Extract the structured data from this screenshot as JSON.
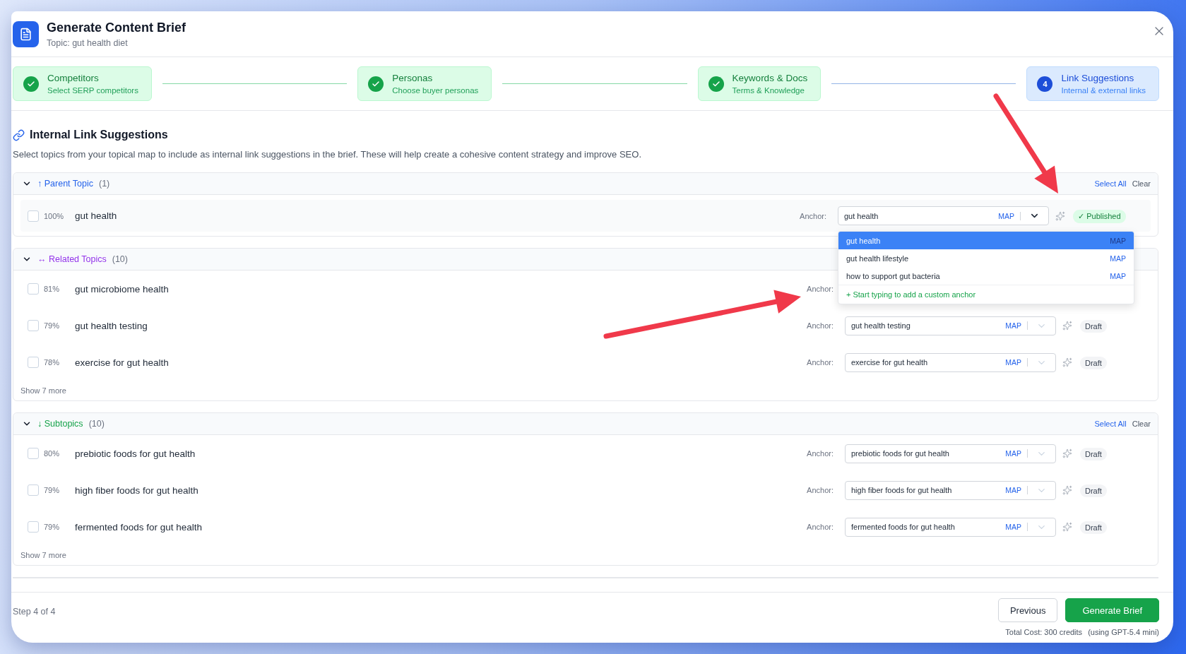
{
  "dialog": {
    "title": "Generate Content Brief",
    "subtitle": "Topic: gut health diet"
  },
  "steps": [
    {
      "title": "Competitors",
      "subtitle": "Select SERP competitors",
      "completed": true
    },
    {
      "title": "Personas",
      "subtitle": "Choose buyer personas",
      "completed": true
    },
    {
      "title": "Keywords & Docs",
      "subtitle": "Terms & Knowledge",
      "completed": true
    },
    {
      "title": "Link Suggestions",
      "subtitle": "Internal & external links",
      "completed": false,
      "number": "4"
    }
  ],
  "section": {
    "title": "Internal Link Suggestions",
    "description": "Select topics from your topical map to include as internal link suggestions in the brief. These will help create a cohesive content strategy and improve SEO."
  },
  "groups": [
    {
      "label": "↑ Parent Topic",
      "count": "(1)",
      "color": "#2563eb",
      "expanded": true,
      "actions": [
        {
          "label": "Select All",
          "kind": "select"
        },
        {
          "label": "Clear",
          "kind": "clear"
        }
      ],
      "rows": [
        {
          "score": "100%",
          "name": "gut health",
          "checked": false,
          "anchor_label": "Anchor:",
          "anchor": {
            "value": "gut health",
            "tag": "MAP",
            "open": true,
            "options": [
              {
                "label": "gut health",
                "tag": "MAP",
                "selected": true
              },
              {
                "label": "gut health lifestyle",
                "tag": "MAP",
                "selected": false
              },
              {
                "label": "how to support gut bacteria",
                "tag": "MAP",
                "selected": false
              }
            ],
            "hint": "+ Start typing to add a custom anchor"
          },
          "status": {
            "kind": "published",
            "label": "✓ Published"
          }
        }
      ]
    },
    {
      "label": "↔ Related Topics",
      "count": "(10)",
      "color": "#9333ea",
      "expanded": true,
      "rows": [
        {
          "score": "81%",
          "name": "gut microbiome health",
          "checked": false,
          "anchor_label": "Anchor:"
        },
        {
          "score": "79%",
          "name": "gut health testing",
          "checked": false,
          "anchor_label": "Anchor:",
          "anchor": {
            "value": "gut health testing",
            "tag": "MAP",
            "open": false
          },
          "status": {
            "kind": "draft",
            "label": "Draft"
          }
        },
        {
          "score": "78%",
          "name": "exercise for gut health",
          "checked": false,
          "anchor_label": "Anchor:",
          "anchor": {
            "value": "exercise for gut health",
            "tag": "MAP",
            "open": false
          },
          "status": {
            "kind": "draft",
            "label": "Draft"
          }
        }
      ],
      "show_more": "Show 7 more"
    },
    {
      "label": "↓ Subtopics",
      "count": "(10)",
      "color": "#16a34a",
      "expanded": true,
      "actions": [
        {
          "label": "Select All",
          "kind": "select"
        },
        {
          "label": "Clear",
          "kind": "clear"
        }
      ],
      "rows": [
        {
          "score": "80%",
          "name": "prebiotic foods for gut health",
          "checked": false,
          "anchor_label": "Anchor:",
          "anchor": {
            "value": "prebiotic foods for gut health",
            "tag": "MAP",
            "open": false
          },
          "status": {
            "kind": "draft",
            "label": "Draft"
          }
        },
        {
          "score": "79%",
          "name": "high fiber foods for gut health",
          "checked": false,
          "anchor_label": "Anchor:",
          "anchor": {
            "value": "high fiber foods for gut health",
            "tag": "MAP",
            "open": false
          },
          "status": {
            "kind": "draft",
            "label": "Draft"
          }
        },
        {
          "score": "79%",
          "name": "fermented foods for gut health",
          "checked": false,
          "anchor_label": "Anchor:",
          "anchor": {
            "value": "fermented foods for gut health",
            "tag": "MAP",
            "open": false
          },
          "status": {
            "kind": "draft",
            "label": "Draft"
          }
        }
      ],
      "show_more": "Show 7 more"
    }
  ],
  "footer": {
    "step": "Step 4 of 4",
    "buttons": [
      {
        "label": "Previous",
        "kind": "secondary"
      },
      {
        "label": "Generate Brief",
        "kind": "primary"
      }
    ],
    "cost": "Total Cost: 300 credits",
    "model": "(using GPT-5.4 mini)"
  }
}
